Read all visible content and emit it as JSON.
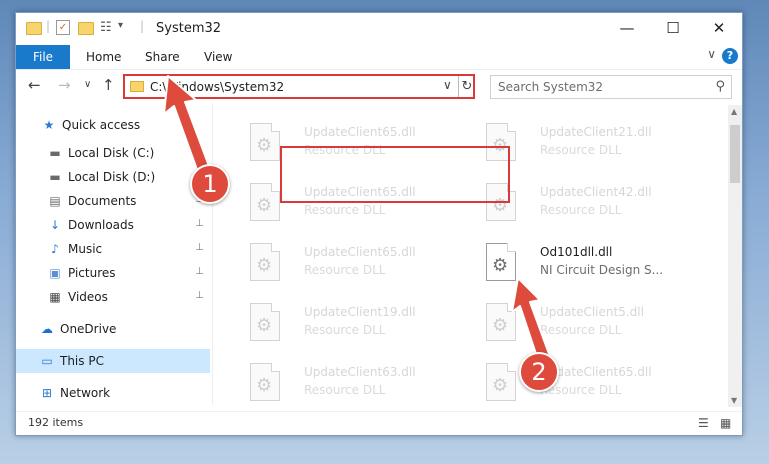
{
  "window": {
    "title": "System32",
    "minimize": "—",
    "maximize": "☐",
    "close": "✕"
  },
  "ribbon": {
    "tabs": [
      "File",
      "Home",
      "Share",
      "View"
    ],
    "collapse": "∨",
    "help": "?"
  },
  "nav": {
    "back": "←",
    "forward": "→",
    "recent": "∨",
    "up": "↑",
    "address": "C:\\Windows\\System32",
    "address_drop": "∨",
    "refresh": "↻",
    "search_placeholder": "Search System32",
    "search_icon": "⚲"
  },
  "sidebar": {
    "items": [
      {
        "label": "Quick access",
        "icon": "star-icon",
        "glyph": "★",
        "color": "#2b79d0",
        "pinned": false
      },
      {
        "label": "Local Disk (C:)",
        "icon": "drive-icon",
        "glyph": "▬",
        "color": "#6a6a6a",
        "pinned": true
      },
      {
        "label": "Local Disk (D:)",
        "icon": "drive-icon",
        "glyph": "▬",
        "color": "#6a6a6a",
        "pinned": true
      },
      {
        "label": "Documents",
        "icon": "documents-icon",
        "glyph": "▤",
        "color": "#6a6a6a",
        "pinned": true
      },
      {
        "label": "Downloads",
        "icon": "downloads-icon",
        "glyph": "↓",
        "color": "#2b79d0",
        "pinned": true
      },
      {
        "label": "Music",
        "icon": "music-icon",
        "glyph": "♪",
        "color": "#2b79d0",
        "pinned": true
      },
      {
        "label": "Pictures",
        "icon": "pictures-icon",
        "glyph": "▣",
        "color": "#5b8fcf",
        "pinned": true
      },
      {
        "label": "Videos",
        "icon": "videos-icon",
        "glyph": "▦",
        "color": "#444444",
        "pinned": true
      },
      {
        "label": "OneDrive",
        "icon": "onedrive-icon",
        "glyph": "☁",
        "color": "#1a6fd0",
        "pinned": false
      },
      {
        "label": "This PC",
        "icon": "pc-icon",
        "glyph": "▭",
        "color": "#2b79d0",
        "pinned": false,
        "selected": true
      },
      {
        "label": "Network",
        "icon": "network-icon",
        "glyph": "⊞",
        "color": "#2b79d0",
        "pinned": false
      }
    ],
    "pin_glyph": "⊥"
  },
  "files": [
    {
      "name": "UpdateClient65.dll",
      "desc": "Resource DLL",
      "highlight": false
    },
    {
      "name": "UpdateClient21.dll",
      "desc": "Resource DLL",
      "highlight": false
    },
    {
      "name": "UpdateClient65.dll",
      "desc": "Resource DLL",
      "highlight": false
    },
    {
      "name": "UpdateClient42.dll",
      "desc": "Resource DLL",
      "highlight": false
    },
    {
      "name": "UpdateClient65.dll",
      "desc": "Resource DLL",
      "highlight": false
    },
    {
      "name": "Od101dll.dll",
      "desc": "NI Circuit Design S...",
      "highlight": true
    },
    {
      "name": "UpdateClient19.dll",
      "desc": "Resource DLL",
      "highlight": false
    },
    {
      "name": "UpdateClient5.dll",
      "desc": "Resource DLL",
      "highlight": false
    },
    {
      "name": "UpdateClient63.dll",
      "desc": "Resource DLL",
      "highlight": false
    },
    {
      "name": "UpdateClient65.dll",
      "desc": "Resource DLL",
      "highlight": false
    }
  ],
  "file_icon": "gear-file-icon",
  "gear_glyph": "⚙",
  "status": {
    "count": "192 items",
    "details_view": "☰",
    "tiles_view": "▦"
  },
  "callouts": [
    "1",
    "2"
  ],
  "colors": {
    "accent": "#1979ca",
    "highlight_box": "#d8393a",
    "badge": "#de4a3b"
  }
}
